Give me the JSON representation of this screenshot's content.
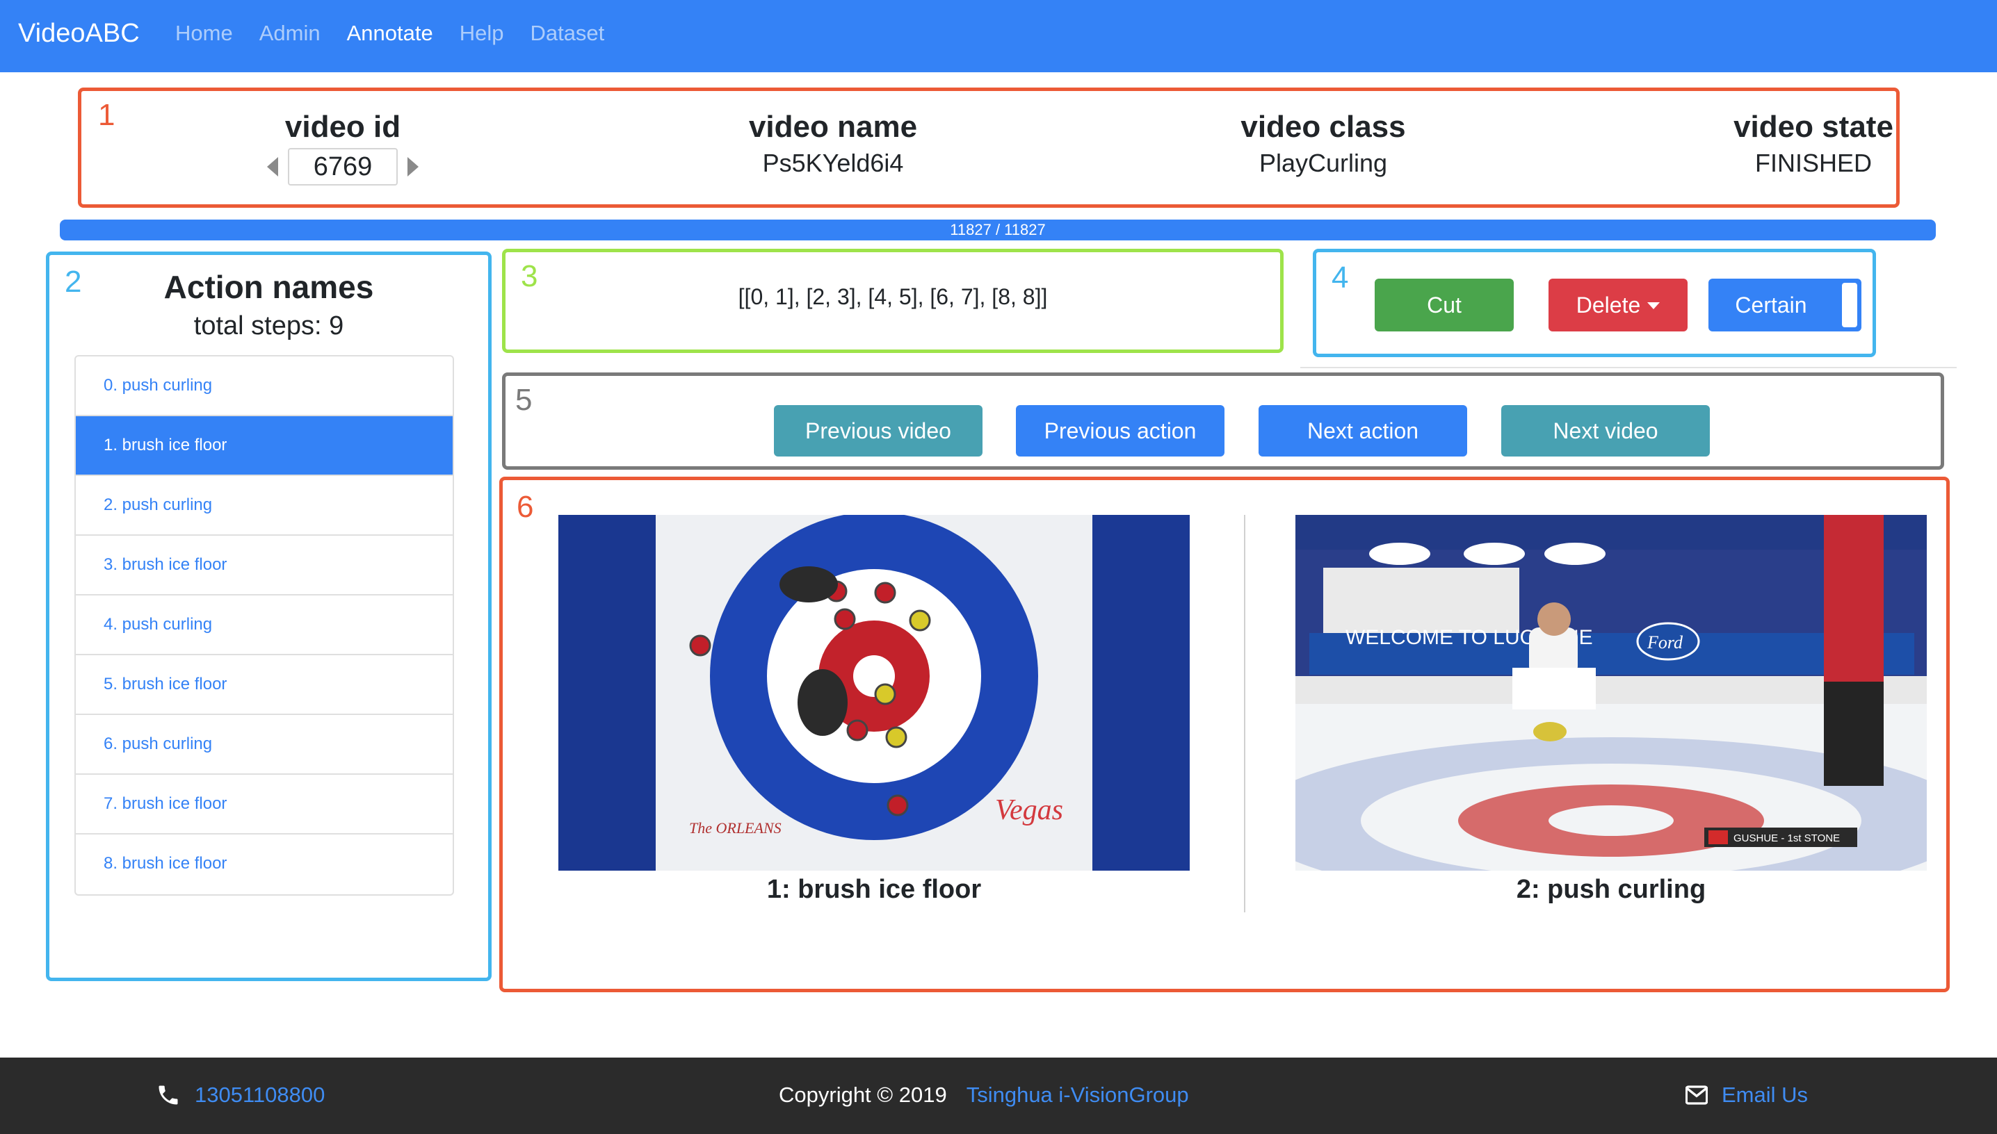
{
  "navbar": {
    "brand": "VideoABC",
    "links": [
      "Home",
      "Admin",
      "Annotate",
      "Help",
      "Dataset"
    ],
    "active": "Annotate",
    "color": "#3482f6"
  },
  "info": {
    "number": "1",
    "video_id_label": "video id",
    "video_id_value": "6769",
    "video_name_label": "video name",
    "video_name_value": "Ps5KYeld6i4",
    "video_class_label": "video class",
    "video_class_value": "PlayCurling",
    "video_state_label": "video state",
    "video_state_value": "FINISHED"
  },
  "progress": {
    "text": "11827 / 11827",
    "current": 11827,
    "total": 11827
  },
  "actions_panel": {
    "number": "2",
    "title": "Action names",
    "steps_text": "total steps: 9",
    "selected_index": 1,
    "items": [
      "0. push curling",
      "1. brush ice floor",
      "2. push curling",
      "3. brush ice floor",
      "4. push curling",
      "5. brush ice floor",
      "6. push curling",
      "7. brush ice floor",
      "8. brush ice floor"
    ]
  },
  "segments": {
    "number": "3",
    "text": "[[0, 1], [2, 3], [4, 5], [6, 7], [8, 8]]"
  },
  "edit_tools": {
    "number": "4",
    "cut_label": "Cut",
    "delete_label": "Delete",
    "certain_label": "Certain",
    "colors": {
      "cut": "#4aa54c",
      "delete": "#dc3d46",
      "certain": "#3482f6"
    }
  },
  "navigation": {
    "number": "5",
    "previous_video": "Previous video",
    "previous_action": "Previous action",
    "next_action": "Next action",
    "next_video": "Next video"
  },
  "preview": {
    "number": "6",
    "left_caption": "1: brush ice floor",
    "right_caption": "2: push curling",
    "left_frame_logo": "Vegas",
    "left_frame_logo_2": "The ORLEANS",
    "right_frame_banner": "WELCOME TO LUCERNE",
    "right_frame_tag": "GUSHUE - 1st STONE",
    "right_frame_ford": "Ford"
  },
  "footer": {
    "phone": "13051108800",
    "copyright": "Copyright © 2019",
    "group": "Tsinghua i-VisionGroup",
    "email": "Email Us"
  }
}
